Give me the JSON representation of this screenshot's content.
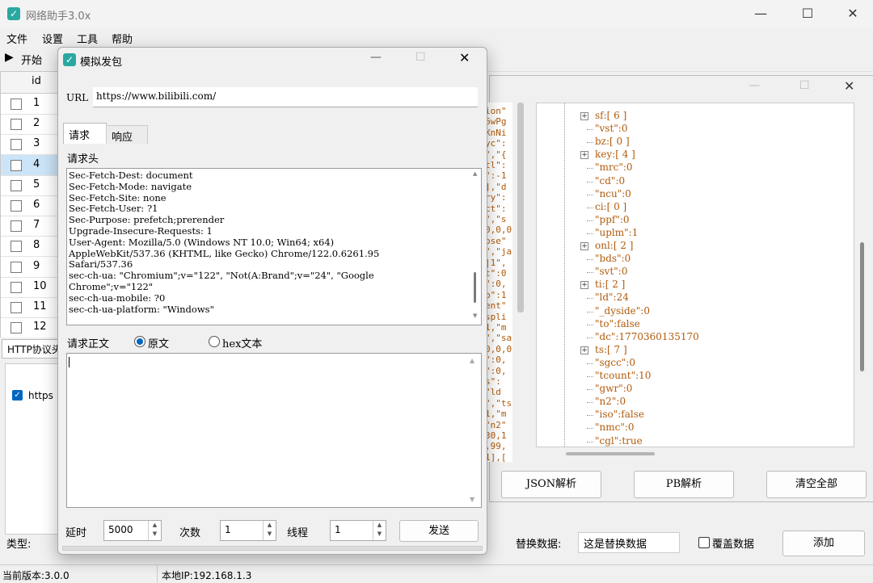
{
  "main_window": {
    "title": "网络助手3.0x",
    "menu": [
      "文件",
      "设置",
      "工具",
      "帮助"
    ],
    "start_label": "开始",
    "table_header_id": "id",
    "rows": [
      {
        "id": "1",
        "checked": false
      },
      {
        "id": "2",
        "checked": false
      },
      {
        "id": "3",
        "checked": false
      },
      {
        "id": "4",
        "checked": false,
        "selected": true
      },
      {
        "id": "5",
        "checked": false
      },
      {
        "id": "6",
        "checked": false
      },
      {
        "id": "7",
        "checked": false
      },
      {
        "id": "8",
        "checked": false
      },
      {
        "id": "9",
        "checked": false
      },
      {
        "id": "10",
        "checked": false
      },
      {
        "id": "11",
        "checked": false
      },
      {
        "id": "12",
        "checked": false
      }
    ],
    "http_tab_label": "HTTP协议头",
    "https_checkbox_label": "https",
    "type_label": "类型:",
    "replace_data_label": "替换数据:",
    "replace_data_value": "这是替换数据",
    "override_label": "覆盖数据",
    "add_label": "添加",
    "status_version": "当前版本:3.0.0",
    "status_ip": "本地IP:192.168.1.3"
  },
  "json_panel": {
    "json_parse_label": "JSON解析",
    "pb_parse_label": "PB解析",
    "clear_all_label": "清空全部",
    "bg_text_lines": [
      "ion\"",
      "6wPg",
      "XnNi",
      "yc\":",
      "\",\"{",
      "tl\":",
      "\":-1",
      "],\"d",
      "ry\":",
      "ct\":",
      "\",\"s",
      "0,0,0",
      "ose\"",
      "\",\"ja",
      "|1\",",
      "t\":0",
      "\":0,",
      "b\":1",
      "ent\"",
      "spli",
      "1,\"m",
      "\",\"sa",
      "0,0,0",
      "\":0,",
      "\":0,",
      "s\":",
      "\"ld",
      "\",\"ts",
      "1,\"m",
      "\"n2\"",
      "30,1",
      ",99,",
      "1],["
    ],
    "tree": [
      {
        "text": "sf:[ 6 ]",
        "expandable": true
      },
      {
        "text": "\"vst\":0",
        "expandable": false
      },
      {
        "text": "bz:[ 0 ]",
        "expandable": false
      },
      {
        "text": "key:[ 4 ]",
        "expandable": true
      },
      {
        "text": "\"mrc\":0",
        "expandable": false
      },
      {
        "text": "\"cd\":0",
        "expandable": false
      },
      {
        "text": "\"ncu\":0",
        "expandable": false
      },
      {
        "text": "ci:[ 0 ]",
        "expandable": false
      },
      {
        "text": "\"ppf\":0",
        "expandable": false
      },
      {
        "text": "\"uplm\":1",
        "expandable": false
      },
      {
        "text": "onl:[ 2 ]",
        "expandable": true
      },
      {
        "text": "\"bds\":0",
        "expandable": false
      },
      {
        "text": "\"svt\":0",
        "expandable": false
      },
      {
        "text": "ti:[ 2 ]",
        "expandable": true
      },
      {
        "text": "\"ld\":24",
        "expandable": false
      },
      {
        "text": "\"_dyside\":0",
        "expandable": false
      },
      {
        "text": "\"to\":false",
        "expandable": false
      },
      {
        "text": "\"dc\":1770360135170",
        "expandable": false
      },
      {
        "text": "ts:[ 7 ]",
        "expandable": true
      },
      {
        "text": "\"sgcc\":0",
        "expandable": false
      },
      {
        "text": "\"tcount\":10",
        "expandable": false
      },
      {
        "text": "\"gwr\":0",
        "expandable": false
      },
      {
        "text": "\"n2\":0",
        "expandable": false
      },
      {
        "text": "\"iso\":false",
        "expandable": false
      },
      {
        "text": "\"nmc\":0",
        "expandable": false
      },
      {
        "text": "\"cgl\":true",
        "expandable": false
      }
    ]
  },
  "dialog": {
    "title": "模拟发包",
    "url_label": "URL",
    "url_value": "https://www.bilibili.com/",
    "tabs": [
      "请求",
      "响应"
    ],
    "headers_label": "请求头",
    "headers_lines": [
      "Sec-Fetch-Dest: document",
      "Sec-Fetch-Mode: navigate",
      "Sec-Fetch-Site: none",
      "Sec-Fetch-User: ?1",
      "Sec-Purpose: prefetch;prerender",
      "Upgrade-Insecure-Requests: 1",
      "User-Agent: Mozilla/5.0 (Windows NT 10.0; Win64; x64)",
      "AppleWebKit/537.36 (KHTML, like Gecko) Chrome/122.0.6261.95",
      "Safari/537.36",
      "sec-ch-ua: \"Chromium\";v=\"122\", \"Not(A:Brand\";v=\"24\", \"Google",
      "Chrome\";v=\"122\"",
      "sec-ch-ua-mobile: ?0",
      "sec-ch-ua-platform: \"Windows\""
    ],
    "body_label": "请求正文",
    "radio_raw": "原文",
    "radio_hex": "hex文本",
    "delay_label": "延时",
    "delay_value": "5000",
    "count_label": "次数",
    "count_value": "1",
    "thread_label": "线程",
    "thread_value": "1",
    "send_label": "发送"
  },
  "colors": {
    "accent": "#2aa8a0",
    "json_text": "#b05a0a",
    "selected_row": "#cce4f7",
    "radio_fill": "#0067c0"
  }
}
